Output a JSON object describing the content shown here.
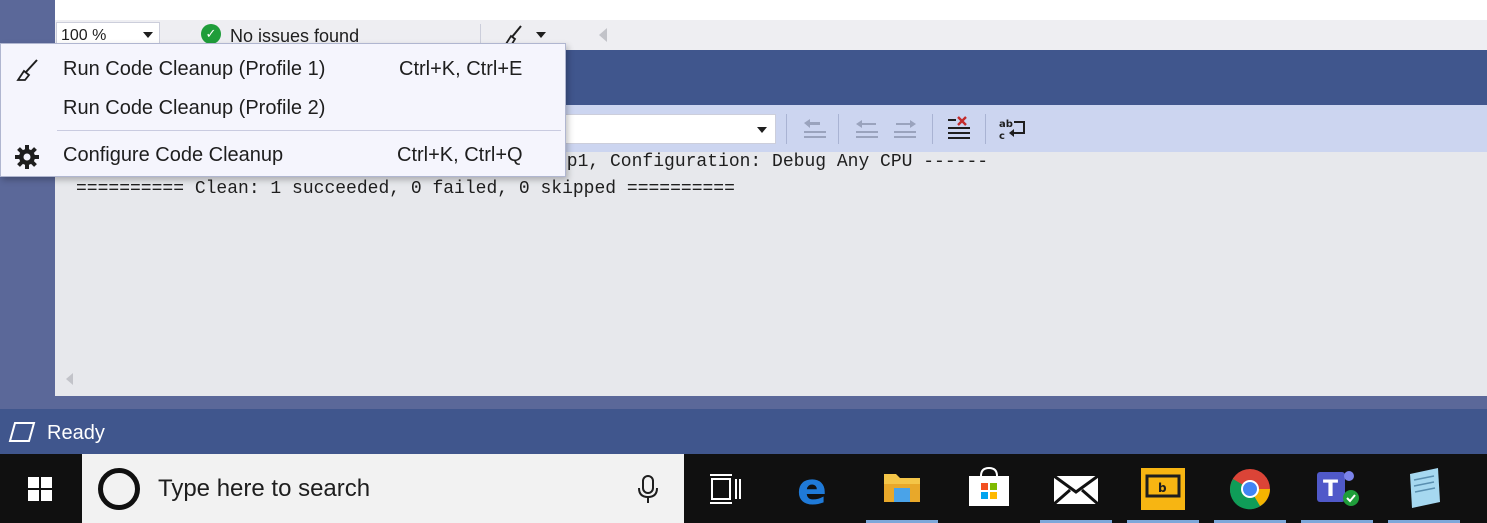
{
  "editor_bar": {
    "zoom": "100 %",
    "status": "No issues found"
  },
  "menu": {
    "items": [
      {
        "label": "Run Code Cleanup (Profile 1)",
        "shortcut": "Ctrl+K, Ctrl+E",
        "icon": "broom-icon"
      },
      {
        "label": "Run Code Cleanup (Profile 2)",
        "shortcut": "",
        "icon": ""
      },
      {
        "label": "Configure Code Cleanup",
        "shortcut": "Ctrl+K, Ctrl+Q",
        "icon": "gear-icon"
      }
    ]
  },
  "output": {
    "lines": [
      "pp1, Configuration: Debug Any CPU ------",
      "========== Clean: 1 succeeded, 0 failed, 0 skipped =========="
    ]
  },
  "status_bar": {
    "text": "Ready"
  },
  "taskbar": {
    "search_placeholder": "Type here to search",
    "apps": [
      "task-view",
      "edge",
      "file-explorer",
      "store",
      "mail",
      "bing",
      "chrome",
      "teams",
      "notepad"
    ]
  },
  "colors": {
    "panel_title": "#40568d",
    "toolbar": "#ccd5f0",
    "output_bg": "#e7e8ec",
    "menu_bg": "#f5f5fd",
    "taskbar": "#101010",
    "ok_green": "#1f9d3a"
  }
}
